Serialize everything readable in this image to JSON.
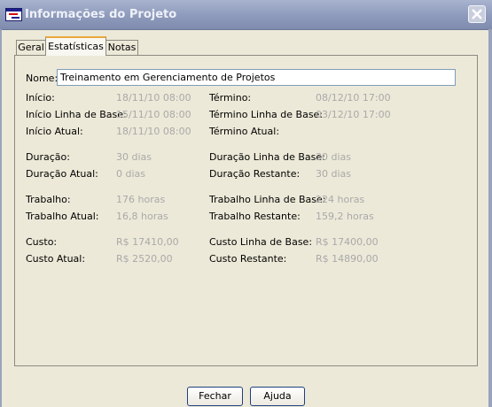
{
  "window": {
    "title": "Informações do Projeto"
  },
  "tabs": [
    {
      "label": "Geral"
    },
    {
      "label": "Estatísticas"
    },
    {
      "label": "Notas"
    }
  ],
  "name": {
    "label": "Nome:",
    "value": "Treinamento em Gerenciamento de Projetos"
  },
  "left": [
    {
      "label": "Início:",
      "value": "18/11/10 08:00"
    },
    {
      "label": "Início Linha de Base:",
      "value": "15/11/10 08:00"
    },
    {
      "label": "Início Atual:",
      "value": "18/11/10 08:00"
    },
    {
      "label": "Duração:",
      "value": "30 dias"
    },
    {
      "label": "Duração Atual:",
      "value": "0 dias"
    },
    {
      "label": "Trabalho:",
      "value": "176 horas"
    },
    {
      "label": "Trabalho Atual:",
      "value": "16,8 horas"
    },
    {
      "label": "Custo:",
      "value": "R$ 17410,00"
    },
    {
      "label": "Custo Atual:",
      "value": "R$ 2520,00"
    }
  ],
  "right": [
    {
      "label": "Término:",
      "value": "08/12/10 17:00"
    },
    {
      "label": "Término Linha de Base:",
      "value": "03/12/10 17:00"
    },
    {
      "label": "Término Atual:",
      "value": ""
    },
    {
      "label": "Duração Linha de Base:",
      "value": "30 dias"
    },
    {
      "label": "Duração Restante:",
      "value": "30 dias"
    },
    {
      "label": "Trabalho Linha de Base:",
      "value": "224 horas"
    },
    {
      "label": "Trabalho Restante:",
      "value": "159,2 horas"
    },
    {
      "label": "Custo Linha de Base:",
      "value": "R$ 17400,00"
    },
    {
      "label": "Custo Restante:",
      "value": "R$ 14890,00"
    }
  ],
  "buttons": {
    "close": "Fechar",
    "help": "Ajuda"
  }
}
